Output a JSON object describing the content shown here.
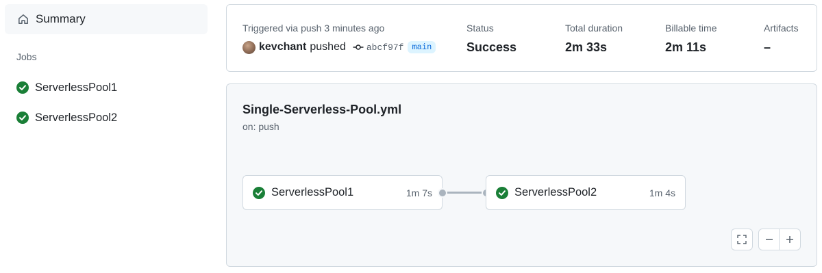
{
  "sidebar": {
    "summary_label": "Summary",
    "summary_icon": "home-icon",
    "jobs_heading": "Jobs",
    "jobs": [
      {
        "label": "ServerlessPool1",
        "status": "success"
      },
      {
        "label": "ServerlessPool2",
        "status": "success"
      }
    ]
  },
  "run_summary": {
    "trigger_text": "Triggered via push 3 minutes ago",
    "actor": "kevchant",
    "action": "pushed",
    "commit_sha": "abcf97f",
    "branch": "main",
    "stats": [
      {
        "label": "Status",
        "value": "Success"
      },
      {
        "label": "Total duration",
        "value": "2m 33s"
      },
      {
        "label": "Billable time",
        "value": "2m 11s"
      },
      {
        "label": "Artifacts",
        "value": "–"
      }
    ]
  },
  "workflow": {
    "file_name": "Single-Serverless-Pool.yml",
    "trigger": "on: push",
    "jobs": [
      {
        "name": "ServerlessPool1",
        "duration": "1m 7s",
        "status": "success"
      },
      {
        "name": "ServerlessPool2",
        "duration": "1m 4s",
        "status": "success"
      }
    ]
  },
  "colors": {
    "success": "#1a7f37",
    "branch_text": "#0969da",
    "branch_bg": "#ddf4ff"
  }
}
